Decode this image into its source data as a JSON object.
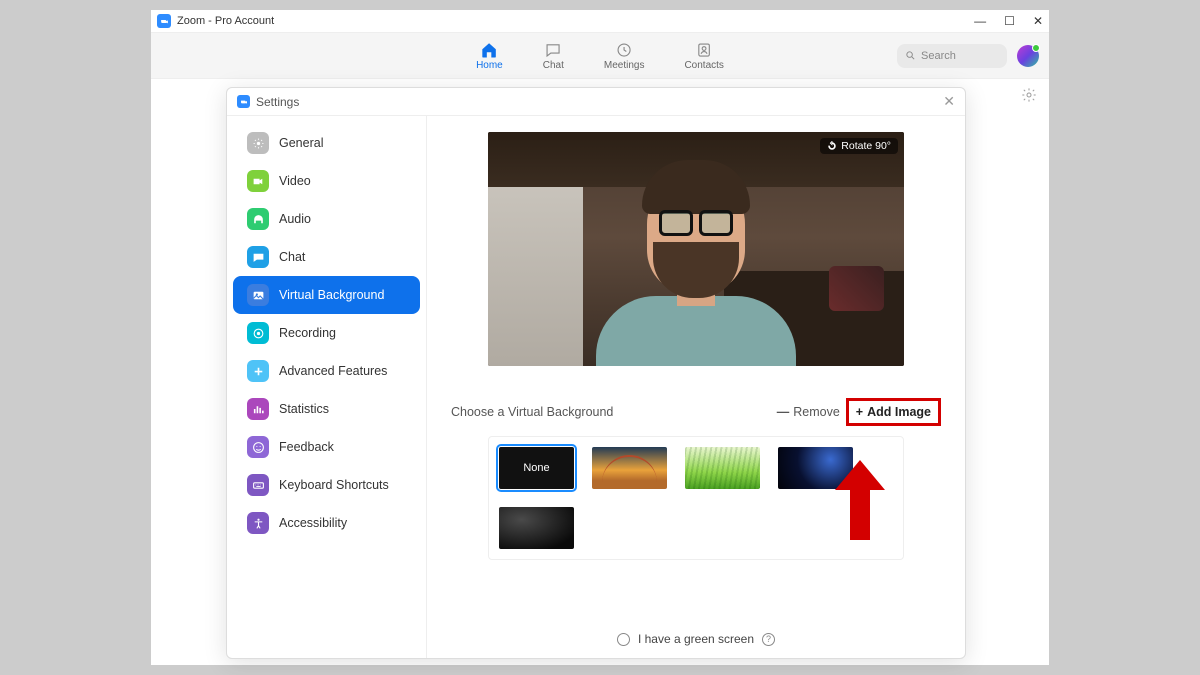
{
  "window": {
    "title": "Zoom - Pro Account"
  },
  "topnav": {
    "tabs": [
      {
        "label": "Home"
      },
      {
        "label": "Chat"
      },
      {
        "label": "Meetings"
      },
      {
        "label": "Contacts"
      }
    ],
    "search_placeholder": "Search"
  },
  "settings": {
    "title": "Settings",
    "sidebar": [
      {
        "label": "General"
      },
      {
        "label": "Video"
      },
      {
        "label": "Audio"
      },
      {
        "label": "Chat"
      },
      {
        "label": "Virtual Background"
      },
      {
        "label": "Recording"
      },
      {
        "label": "Advanced Features"
      },
      {
        "label": "Statistics"
      },
      {
        "label": "Feedback"
      },
      {
        "label": "Keyboard Shortcuts"
      },
      {
        "label": "Accessibility"
      }
    ],
    "rotate_label": "Rotate 90°",
    "choose_label": "Choose a Virtual Background",
    "remove_label": "Remove",
    "add_image_label": "Add Image",
    "none_label": "None",
    "green_screen_label": "I have a green screen"
  }
}
